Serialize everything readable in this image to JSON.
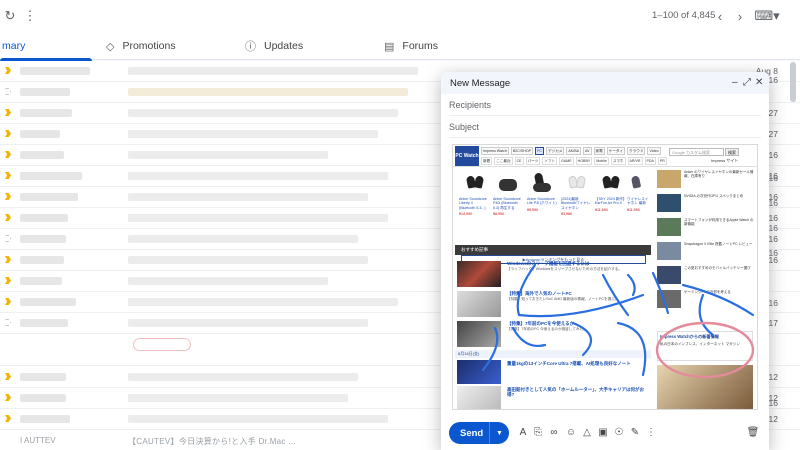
{
  "toolbar": {
    "range_text": "1–100 of 4,845",
    "refresh_icon": "refresh-icon",
    "more_icon": "more-vert-icon",
    "prev_icon": "chevron-left-icon",
    "next_icon": "chevron-right-icon",
    "input_tools_icon": "keyboard-icon"
  },
  "tabs": [
    {
      "label": "mary",
      "icon": "inbox-icon"
    },
    {
      "label": "Promotions",
      "icon": "tag-icon"
    },
    {
      "label": "Updates",
      "icon": "info-icon"
    },
    {
      "label": "Forums",
      "icon": "forum-icon"
    }
  ],
  "list": {
    "first_date": "Aug 8",
    "visible_dates": [
      "27",
      "27",
      "16",
      "16",
      "16",
      "16",
      "16",
      "16",
      "17",
      "12",
      "12",
      "12"
    ],
    "last_row_sender": "I AUTTEV",
    "last_row_snippet": "【CAUTEV】今日決算から!と入手 Dr.Mac ..."
  },
  "compose": {
    "title": "New Message",
    "recipients_placeholder": "Recipients",
    "subject_placeholder": "Subject",
    "send_label": "Send",
    "minimize_icon": "minimize-icon",
    "popout_icon": "popout-icon",
    "close_icon": "close-icon"
  },
  "embedded_page": {
    "logo": "PC Watch",
    "nav": [
      "Impress Watch",
      "B2C/SHOP",
      "PC",
      "デジカメ",
      "AKIBA",
      "AV",
      "家電",
      "ケータイ",
      "クラウド",
      "Video"
    ],
    "nav2": [
      "新着",
      "ここ最近",
      "CE",
      "パーツ",
      "ソフト",
      "GAME",
      "HOBBY",
      "Mobile",
      "スマホ",
      "AR/VR",
      "PDA",
      "PR"
    ],
    "search_placeholder": "Google カスタム検索",
    "search_button": "検索",
    "menu_label": "Impress サイト",
    "products": [
      {
        "desc": "Anker Soundcore Liberty 4 (Bluetooth 5.3...)",
        "price": "¥14,990"
      },
      {
        "desc": "Anker Soundcore P40i (Bluetooth 5.3) 再生する",
        "price": "¥8,990"
      },
      {
        "desc": "Anker Soundcore Life P3i (ホワイト)",
        "price": "¥5,990"
      },
      {
        "desc": "(2024)最新 Bluetoothワイヤレスイヤホン",
        "price": "¥3,980"
      },
      {
        "desc": "【SKY 2024 新作】EarFun Air Pro 4",
        "price": "¥11,690"
      },
      {
        "desc": "ワイヤレスイヤホン 最新",
        "price": "¥11,990"
      }
    ],
    "amazon_button": "▶Amazonランキングをもっと見る",
    "section_title": "おすすめ記事",
    "articles": [
      {
        "title": "Windowsのスリープ機能を回避するには",
        "sub": "【ライフハック】Windowsをスリープさせないための方法を紹介する。"
      },
      {
        "title": "【特集】海外で人気のノートPC",
        "sub": "【特集】知っておきたいSoC AMD 最新版の情報。ノートPCを選ぶ。"
      },
      {
        "title": "【特集】7年前のPCを今使えるか",
        "sub": "【特集】7年前のPC 今使えるのか検証してみた。"
      }
    ],
    "date_label": "8月16日(金)",
    "bottom_articles": [
      {
        "title": "重量1kgの13インチCore Ultra 7搭載、AI処理も良好なノート",
        "sub": ""
      },
      {
        "title": "高田鉛付きとして人気の「ホームルーター」、大手キャリアは何がお得?",
        "sub": ""
      }
    ],
    "side_items": [
      "Anker のワイヤレスイヤホンの最新セール情報、在庫有り",
      "NVIDIA の次世代GPU スペックまとめ",
      "スマートフォンが利用できるApple Watch の新機能",
      "Snapdragon X Elite 搭載ノートPC レビュー",
      "この夏おすすめのモバイルバッテリー選び",
      "ゲーミングPCの冷却を考える"
    ],
    "side_dates": [
      "16",
      "16",
      "16",
      "16",
      "16",
      "16",
      "16"
    ],
    "side_card_title": "Impress Watchからの新着情報",
    "side_card_sub": "私の日本のインプレス、インターネット マガジン",
    "headline_brand": "Impress Watch"
  },
  "compose_bottom_icons": [
    "format-text-icon",
    "attach-icon",
    "link-icon",
    "emoji-icon",
    "drive-icon",
    "image-icon",
    "lock-icon",
    "pen-icon",
    "more-vert-icon",
    "trash-icon"
  ]
}
